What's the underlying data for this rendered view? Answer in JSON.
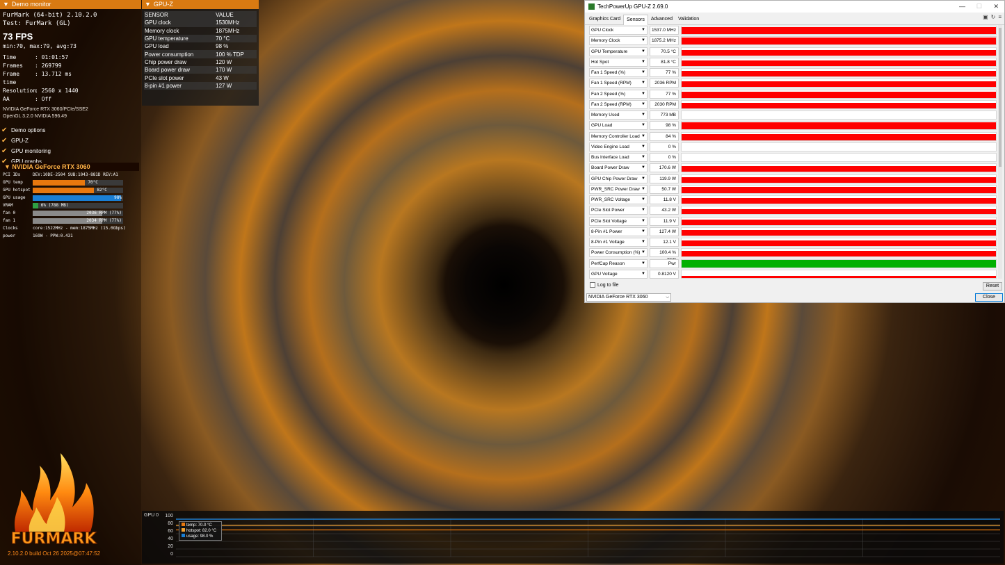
{
  "left": {
    "header": "Demo monitor",
    "app_line": "FurMark (64-bit) 2.10.2.0",
    "test_line": "Test: FurMark (GL)",
    "fps": "73 FPS",
    "minmax": "min:70, max:79, avg:73",
    "stats": [
      {
        "k": "Time",
        "v": ": 01:01:57"
      },
      {
        "k": "Frames",
        "v": ": 269799"
      },
      {
        "k": "Frame time",
        "v": ": 13.712 ms"
      },
      {
        "k": "Resolution",
        "v": ": 2560 x 1440"
      },
      {
        "k": "AA",
        "v": ": Off"
      }
    ],
    "driver1": "NVIDIA GeForce RTX 3060/PCIe/SSE2",
    "driver2": "OpenGL 3.2.0 NVIDIA 596.49",
    "checks": [
      "Demo options",
      "GPU-Z",
      "GPU monitoring",
      "GPU graphs"
    ]
  },
  "gpu_panel": {
    "title": "NVIDIA GeForce RTX 3060",
    "pci_k": "PCI IDs",
    "pci_v": "DEV:10DE-2504 SUB:1043-881D REV:A1",
    "rows": [
      {
        "k": "GPU temp",
        "v": "70°C",
        "frac": 0.58,
        "color": "#e8780e"
      },
      {
        "k": "GPU hotspot",
        "v": "82°C",
        "frac": 0.68,
        "color": "#e8780e"
      },
      {
        "k": "GPU usage",
        "v": "98%",
        "frac": 0.98,
        "color": "#1a7fd4"
      },
      {
        "k": "VRAM",
        "v": "6% (788 MB)",
        "frac": 0.06,
        "color": "#2ea043"
      },
      {
        "k": "fan 0",
        "v": "2036 RPM (77%)",
        "frac": 0.77,
        "color": "#8a8a8a"
      },
      {
        "k": "fan 1",
        "v": "2034 RPM (77%)",
        "frac": 0.77,
        "color": "#8a8a8a"
      }
    ],
    "clocks_k": "Clocks",
    "clocks_v": "core:1522MHz - mem:1875MHz (15.0Gbps)",
    "power_k": "power",
    "power_v": "169W - PPW:0.431"
  },
  "logo": {
    "text": "FURMARK"
  },
  "build": "2.10.2.0 build Oct 26 2025@07:47:52",
  "gpuz_overlay": {
    "title": "GPU-Z",
    "col_sensor": "SENSOR",
    "col_value": "VALUE",
    "rows": [
      {
        "s": "GPU clock",
        "v": "1530MHz"
      },
      {
        "s": "Memory clock",
        "v": "1875MHz"
      },
      {
        "s": "GPU temperature",
        "v": "70 °C"
      },
      {
        "s": "GPU load",
        "v": "98 %"
      },
      {
        "s": "Power consumption",
        "v": "100 % TDP"
      },
      {
        "s": "Chip power draw",
        "v": "120 W"
      },
      {
        "s": "Board power draw",
        "v": "170 W"
      },
      {
        "s": "PCIe slot power",
        "v": "43 W"
      },
      {
        "s": "8-pin #1 power",
        "v": "127 W"
      }
    ]
  },
  "gpuz": {
    "title": "TechPowerUp GPU-Z 2.69.0",
    "tabs": [
      "Graphics Card",
      "Sensors",
      "Advanced",
      "Validation"
    ],
    "sensors": [
      {
        "name": "GPU Clock",
        "value": "1537.0 MHz",
        "fill": 0.9,
        "color": "#ff0000"
      },
      {
        "name": "Memory Clock",
        "value": "1875.2 MHz",
        "fill": 0.9,
        "color": "#ff0000"
      },
      {
        "name": "GPU Temperature",
        "value": "70.5 °C",
        "fill": 0.7,
        "color": "#ff0000"
      },
      {
        "name": "Hot Spot",
        "value": "81.8 °C",
        "fill": 0.7,
        "color": "#ff0000"
      },
      {
        "name": "Fan 1 Speed (%)",
        "value": "77 %",
        "fill": 0.75,
        "color": "#ff0000"
      },
      {
        "name": "Fan 1 Speed (RPM)",
        "value": "2036 RPM",
        "fill": 0.75,
        "color": "#ff0000"
      },
      {
        "name": "Fan 2 Speed (%)",
        "value": "77 %",
        "fill": 0.75,
        "color": "#ff0000"
      },
      {
        "name": "Fan 2 Speed (RPM)",
        "value": "2030 RPM",
        "fill": 0.75,
        "color": "#ff0000"
      },
      {
        "name": "Memory Used",
        "value": "773 MB",
        "fill": 0.0,
        "color": "#ff0000"
      },
      {
        "name": "GPU Load",
        "value": "98 %",
        "fill": 0.9,
        "color": "#ff0000"
      },
      {
        "name": "Memory Controller Load",
        "value": "84 %",
        "fill": 0.8,
        "color": "#ff0000"
      },
      {
        "name": "Video Engine Load",
        "value": "0 %",
        "fill": 0.0,
        "color": "#ff0000"
      },
      {
        "name": "Bus Interface Load",
        "value": "0 %",
        "fill": 0.0,
        "color": "#ff0000"
      },
      {
        "name": "Board Power Draw",
        "value": "170.6 W",
        "fill": 0.8,
        "color": "#ff0000"
      },
      {
        "name": "GPU Chip Power Draw",
        "value": "119.9 W",
        "fill": 0.7,
        "color": "#ff0000"
      },
      {
        "name": "PWR_SRC Power Draw",
        "value": "50.7 W",
        "fill": 0.8,
        "color": "#ff0000"
      },
      {
        "name": "PWR_SRC Voltage",
        "value": "11.8 V",
        "fill": 0.7,
        "color": "#ff0000"
      },
      {
        "name": "PCIe Slot Power",
        "value": "43.2 W",
        "fill": 0.7,
        "color": "#ff0000"
      },
      {
        "name": "PCIe Slot Voltage",
        "value": "11.9 V",
        "fill": 0.7,
        "color": "#ff0000"
      },
      {
        "name": "8-Pin #1 Power",
        "value": "127.4 W",
        "fill": 0.7,
        "color": "#ff0000"
      },
      {
        "name": "8-Pin #1 Voltage",
        "value": "12.1 V",
        "fill": 0.7,
        "color": "#ff0000"
      },
      {
        "name": "Power Consumption (%)",
        "value": "100.4 % TDP",
        "fill": 0.8,
        "color": "#ff0000"
      },
      {
        "name": "PerfCap Reason",
        "value": "Pwr",
        "fill": 1.0,
        "color": "#00b000"
      },
      {
        "name": "GPU Voltage",
        "value": "0.8120 V",
        "fill": 0.3,
        "color": "#ff0000"
      }
    ],
    "log_label": "Log to file",
    "reset": "Reset",
    "close": "Close",
    "gpu_select": "NVIDIA GeForce RTX 3060"
  },
  "graph": {
    "title": "GPU 0",
    "yticks": [
      "100",
      "80",
      "60",
      "40",
      "20",
      "0"
    ],
    "legend": [
      {
        "label": "temp: 70.0 °C",
        "color": "#e8780e"
      },
      {
        "label": "hotspot: 82.0 °C",
        "color": "#f0a030"
      },
      {
        "label": "usage: 98.0 %",
        "color": "#1a7fd4"
      }
    ]
  },
  "chart_data": {
    "type": "line",
    "ylim": [
      0,
      100
    ],
    "series": [
      {
        "name": "temp",
        "values": [
          70,
          70,
          70,
          70,
          70,
          70,
          70,
          70,
          70,
          70
        ]
      },
      {
        "name": "hotspot",
        "values": [
          82,
          82,
          82,
          82,
          82,
          82,
          82,
          82,
          82,
          82
        ]
      },
      {
        "name": "usage",
        "values": [
          98,
          98,
          98,
          98,
          98,
          98,
          98,
          98,
          98,
          98
        ]
      }
    ]
  }
}
